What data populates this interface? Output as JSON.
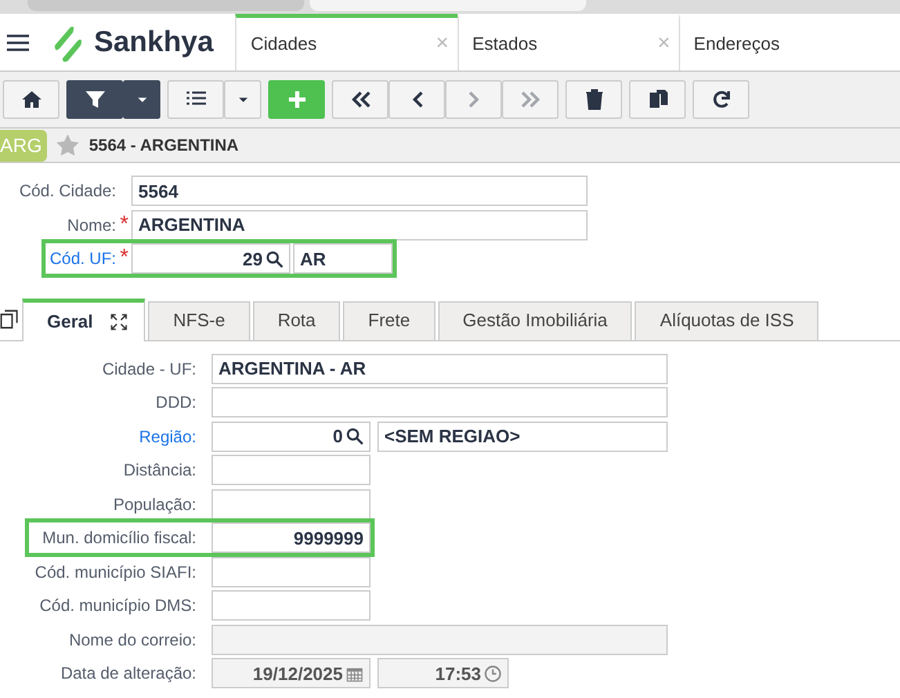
{
  "app": {
    "logo": "Sankhya"
  },
  "screen_tabs": [
    {
      "label": "Cidades",
      "close": "×",
      "selected": true
    },
    {
      "label": "Estados",
      "close": "×",
      "selected": false
    },
    {
      "label": "Endereços",
      "selected": false
    }
  ],
  "toolbar": [
    {
      "kind": "home",
      "disabled": false
    },
    {
      "kind": "filter",
      "disabled": false
    },
    {
      "kind": "list",
      "disabled": false
    },
    {
      "kind": "add",
      "disabled": false
    },
    {
      "kind": "first",
      "disabled": false
    },
    {
      "kind": "prev",
      "disabled": false
    },
    {
      "kind": "next",
      "disabled": true
    },
    {
      "kind": "last",
      "disabled": true
    },
    {
      "kind": "delete",
      "disabled": false
    },
    {
      "kind": "copy",
      "disabled": false
    },
    {
      "kind": "refresh",
      "disabled": false
    }
  ],
  "record": {
    "badge": "ARG",
    "title": "5564 - ARGENTINA"
  },
  "header_fields": [
    {
      "label": "Cód. Cidade:",
      "kind": "text",
      "value": "5564",
      "link": false,
      "highlighted": false
    },
    {
      "label": "Nome:",
      "required_mark": "*",
      "kind": "text",
      "value": "ARGENTINA",
      "link": false,
      "highlighted": false
    },
    {
      "label": "Cód. UF:",
      "required_mark": "*",
      "kind": "lookup",
      "code": "29",
      "description": "AR",
      "link": true,
      "highlighted": true
    }
  ],
  "detail_tabs": [
    {
      "label": "Geral",
      "selected": true
    },
    {
      "label": "NFS-e",
      "selected": false
    },
    {
      "label": "Rota",
      "selected": false
    },
    {
      "label": "Frete",
      "selected": false
    },
    {
      "label": "Gestão Imobiliária",
      "selected": false
    },
    {
      "label": "Alíquotas de ISS",
      "selected": false
    }
  ],
  "fields": [
    {
      "label": "Cidade - UF:",
      "kind": "text",
      "value": "ARGENTINA - AR",
      "link": false,
      "disabled": false,
      "highlighted": false
    },
    {
      "label": "DDD:",
      "kind": "text",
      "link": false,
      "disabled": false,
      "highlighted": false
    },
    {
      "label": "Região:",
      "kind": "lookup",
      "code": "0",
      "description": "<SEM REGIAO>",
      "link": true,
      "disabled": false,
      "highlighted": false
    },
    {
      "label": "Distância:",
      "kind": "short",
      "link": false,
      "disabled": false,
      "highlighted": false
    },
    {
      "label": "População:",
      "kind": "short",
      "link": false,
      "disabled": false,
      "highlighted": false
    },
    {
      "label": "Mun. domicílio fiscal:",
      "kind": "short",
      "value": "9999999",
      "link": false,
      "disabled": false,
      "highlighted": true
    },
    {
      "label": "Cód. município SIAFI:",
      "kind": "short",
      "link": false,
      "disabled": false,
      "highlighted": false
    },
    {
      "label": "Cód. município DMS:",
      "kind": "short",
      "link": false,
      "disabled": false,
      "highlighted": false
    },
    {
      "label": "Nome do correio:",
      "kind": "text",
      "link": false,
      "disabled": true,
      "highlighted": false
    },
    {
      "label": "Data de alteração:",
      "kind": "datetime",
      "date": "19/12/2025",
      "time": "17:53",
      "link": false,
      "disabled": true,
      "highlighted": false
    }
  ]
}
